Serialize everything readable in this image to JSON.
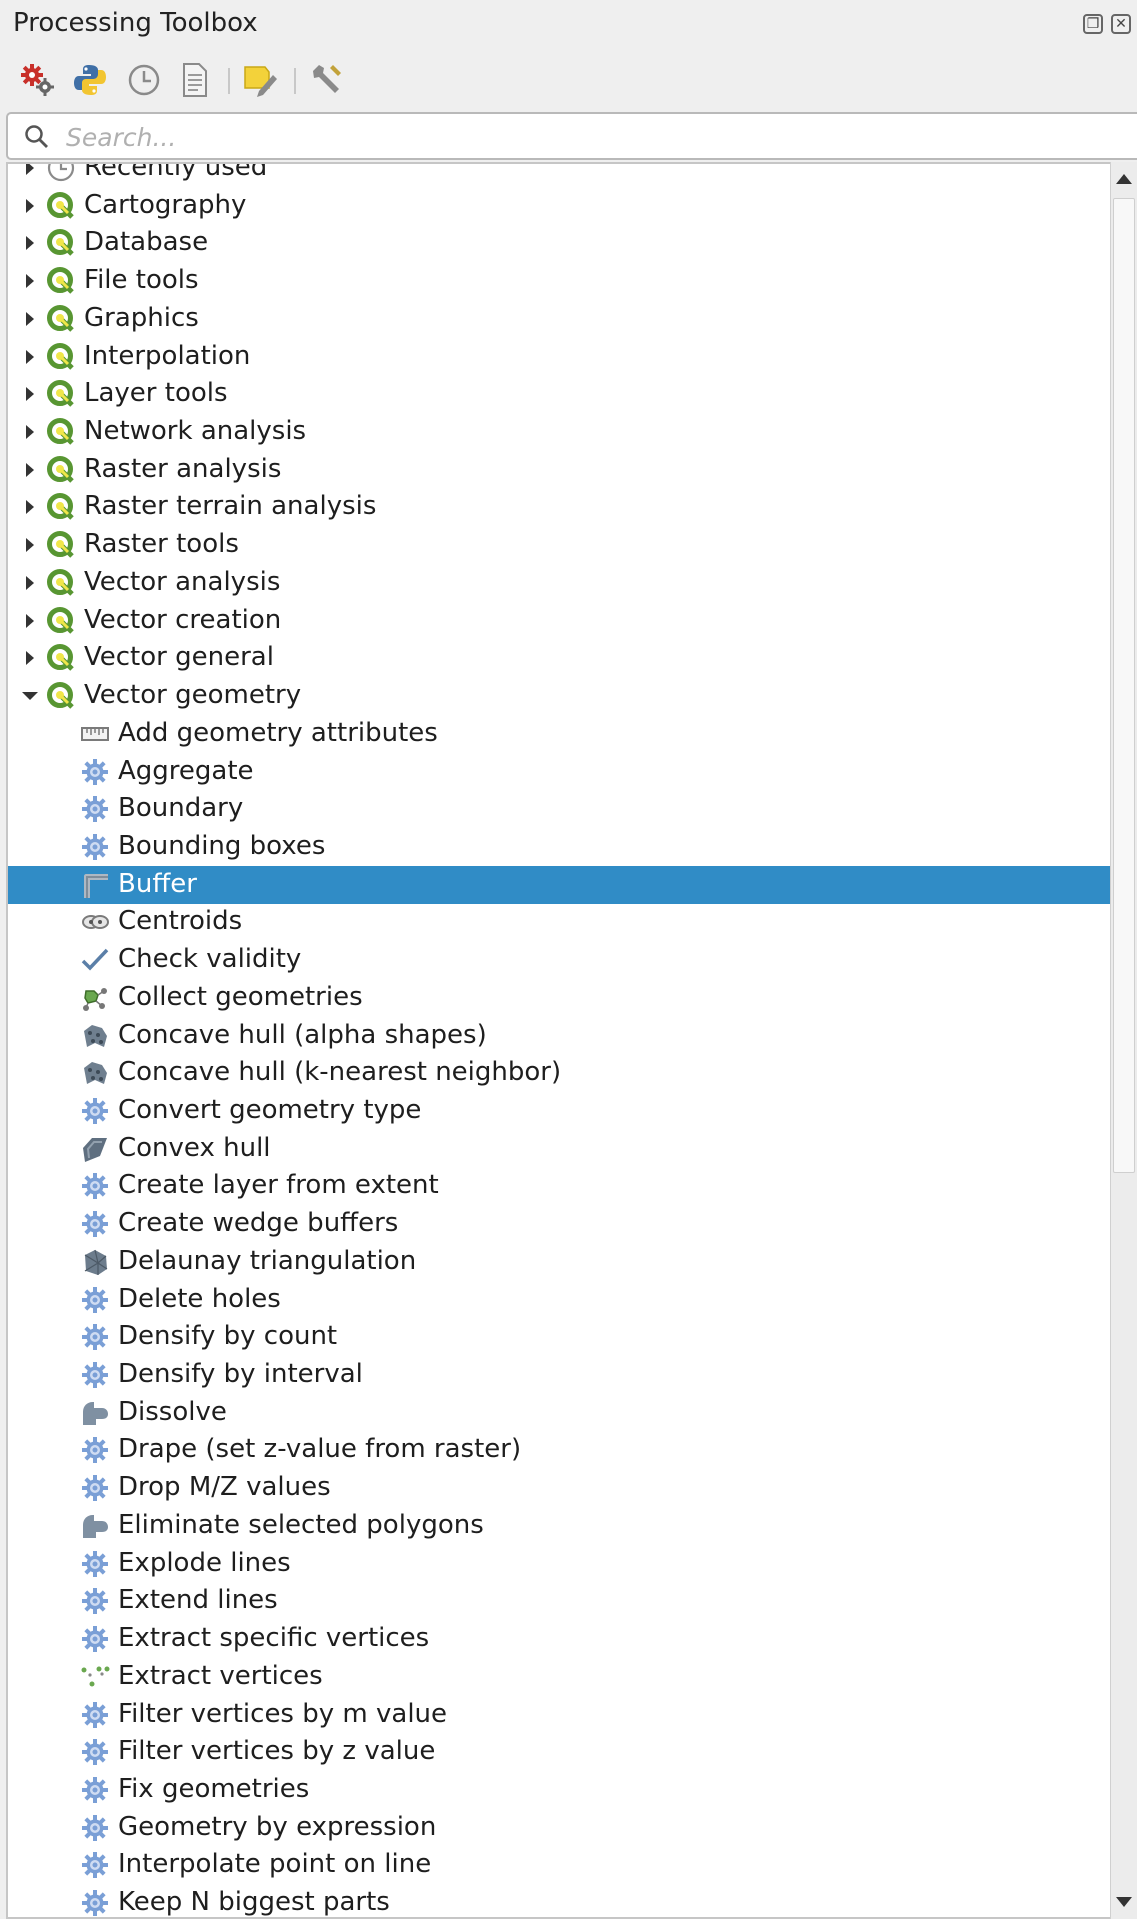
{
  "window": {
    "title": "Processing Toolbox",
    "float_button_glyph": "❐",
    "close_button_glyph": "✕"
  },
  "toolbar": {
    "buttons": [
      {
        "name": "models-icon"
      },
      {
        "name": "python-scripts-icon"
      },
      {
        "name": "history-icon"
      },
      {
        "name": "results-viewer-icon"
      },
      {
        "name": "edit-features-in-place-icon"
      },
      {
        "name": "options-icon"
      }
    ]
  },
  "search": {
    "placeholder": "Search...",
    "value": ""
  },
  "tree": {
    "groups": [
      {
        "label": "Recently used",
        "icon": "clock-icon",
        "expanded": false
      },
      {
        "label": "Cartography",
        "icon": "qgis-icon",
        "expanded": false
      },
      {
        "label": "Database",
        "icon": "qgis-icon",
        "expanded": false
      },
      {
        "label": "File tools",
        "icon": "qgis-icon",
        "expanded": false
      },
      {
        "label": "Graphics",
        "icon": "qgis-icon",
        "expanded": false
      },
      {
        "label": "Interpolation",
        "icon": "qgis-icon",
        "expanded": false
      },
      {
        "label": "Layer tools",
        "icon": "qgis-icon",
        "expanded": false
      },
      {
        "label": "Network analysis",
        "icon": "qgis-icon",
        "expanded": false
      },
      {
        "label": "Raster analysis",
        "icon": "qgis-icon",
        "expanded": false
      },
      {
        "label": "Raster terrain analysis",
        "icon": "qgis-icon",
        "expanded": false
      },
      {
        "label": "Raster tools",
        "icon": "qgis-icon",
        "expanded": false
      },
      {
        "label": "Vector analysis",
        "icon": "qgis-icon",
        "expanded": false
      },
      {
        "label": "Vector creation",
        "icon": "qgis-icon",
        "expanded": false
      },
      {
        "label": "Vector general",
        "icon": "qgis-icon",
        "expanded": false
      },
      {
        "label": "Vector geometry",
        "icon": "qgis-icon",
        "expanded": true
      }
    ],
    "children": [
      {
        "label": "Add geometry attributes",
        "icon": "ruler-icon"
      },
      {
        "label": "Aggregate",
        "icon": "gear-icon"
      },
      {
        "label": "Boundary",
        "icon": "gear-icon"
      },
      {
        "label": "Bounding boxes",
        "icon": "gear-icon"
      },
      {
        "label": "Buffer",
        "icon": "buffer-icon",
        "selected": true
      },
      {
        "label": "Centroids",
        "icon": "centroids-icon"
      },
      {
        "label": "Check validity",
        "icon": "checkmark-icon"
      },
      {
        "label": "Collect geometries",
        "icon": "collect-icon"
      },
      {
        "label": "Concave hull (alpha shapes)",
        "icon": "concave-hull-icon"
      },
      {
        "label": "Concave hull (k-nearest neighbor)",
        "icon": "concave-hull-icon"
      },
      {
        "label": "Convert geometry type",
        "icon": "gear-icon"
      },
      {
        "label": "Convex hull",
        "icon": "convex-hull-icon"
      },
      {
        "label": "Create layer from extent",
        "icon": "gear-icon"
      },
      {
        "label": "Create wedge buffers",
        "icon": "gear-icon"
      },
      {
        "label": "Delaunay triangulation",
        "icon": "delaunay-icon"
      },
      {
        "label": "Delete holes",
        "icon": "gear-icon"
      },
      {
        "label": "Densify by count",
        "icon": "gear-icon"
      },
      {
        "label": "Densify by interval",
        "icon": "gear-icon"
      },
      {
        "label": "Dissolve",
        "icon": "dissolve-icon"
      },
      {
        "label": "Drape (set z-value from raster)",
        "icon": "gear-icon"
      },
      {
        "label": "Drop M/Z values",
        "icon": "gear-icon"
      },
      {
        "label": "Eliminate selected polygons",
        "icon": "dissolve-icon"
      },
      {
        "label": "Explode lines",
        "icon": "gear-icon"
      },
      {
        "label": "Extend lines",
        "icon": "gear-icon"
      },
      {
        "label": "Extract specific vertices",
        "icon": "gear-icon"
      },
      {
        "label": "Extract vertices",
        "icon": "vertices-icon"
      },
      {
        "label": "Filter vertices by m value",
        "icon": "gear-icon"
      },
      {
        "label": "Filter vertices by z value",
        "icon": "gear-icon"
      },
      {
        "label": "Fix geometries",
        "icon": "gear-icon"
      },
      {
        "label": "Geometry by expression",
        "icon": "gear-icon"
      },
      {
        "label": "Interpolate point on line",
        "icon": "gear-icon"
      },
      {
        "label": "Keep N biggest parts",
        "icon": "gear-icon"
      }
    ]
  },
  "colors": {
    "selection": "#308cc6",
    "qgis_green": "#589632",
    "qgis_yellow": "#f0e64a",
    "gear_blue": "#7a9fd6"
  }
}
